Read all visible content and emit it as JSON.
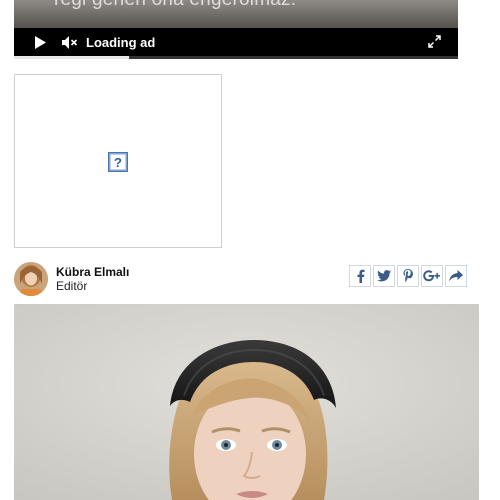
{
  "video": {
    "caption": "regi gerieri ona engeroimaz.",
    "loading_label": "Loading ad",
    "progress": 0.26,
    "play_icon": "play-icon",
    "mute_icon": "mute-icon",
    "fullscreen_icon": "fullscreen-icon"
  },
  "ad": {
    "placeholder_icon": "broken-image-icon",
    "placeholder_glyph": "?"
  },
  "author": {
    "name": "Kübra Elmalı",
    "role": "Editör",
    "avatar_icon": "avatar"
  },
  "share": {
    "buttons": [
      {
        "name": "facebook",
        "glyph": "f"
      },
      {
        "name": "twitter",
        "glyph": "twitter-bird"
      },
      {
        "name": "pinterest",
        "glyph": "P"
      },
      {
        "name": "google-plus",
        "glyph": "G+"
      },
      {
        "name": "share",
        "glyph": "share-arrow"
      }
    ],
    "accent": "#3b5b8a"
  },
  "article_photo": {
    "subject": "girl-portrait-with-headband"
  }
}
